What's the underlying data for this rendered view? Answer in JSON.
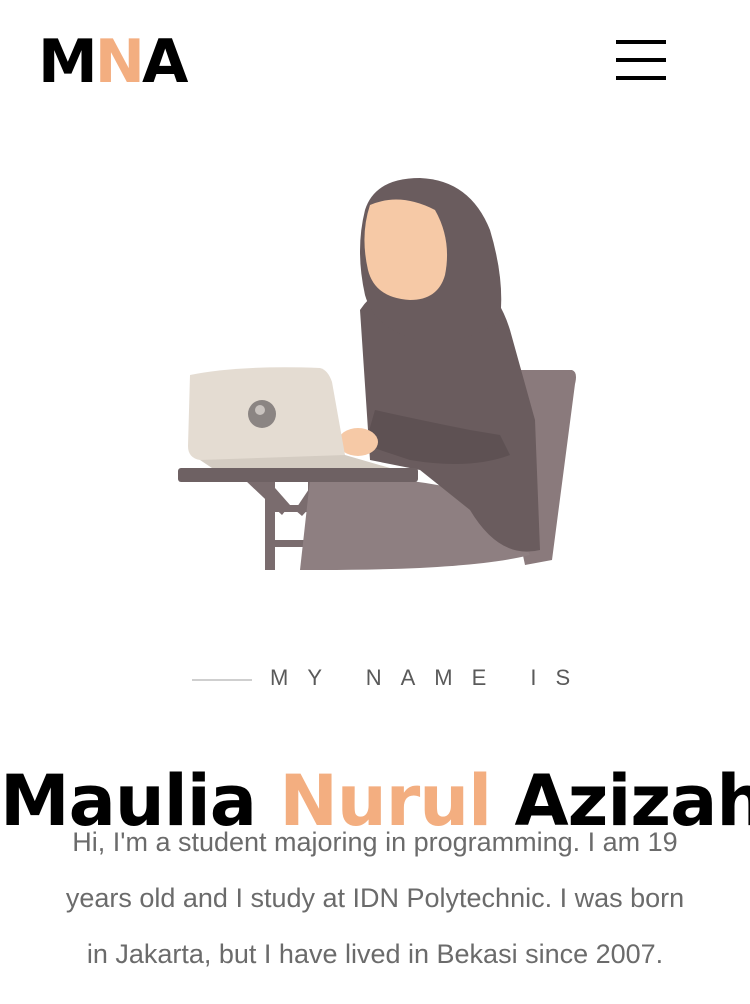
{
  "header": {
    "logo": [
      "M",
      "N",
      "A"
    ],
    "menu_icon": "hamburger-menu-icon"
  },
  "hero": {
    "illustration": "woman-with-laptop-illustration"
  },
  "intro": {
    "label": "MY NAME IS"
  },
  "name": {
    "first": "Maulia",
    "middle": "Nurul",
    "last": "Azizah"
  },
  "bio": {
    "line1": "Hi, I'm a student majoring in programming. I am 19",
    "line2": "years old and I study at IDN Polytechnic. I was born",
    "line3": "in Jakarta, but I have lived in Bekasi since 2007."
  },
  "colors": {
    "accent": "#f3ae80",
    "text": "#000000",
    "muted": "#6b6b6b"
  }
}
